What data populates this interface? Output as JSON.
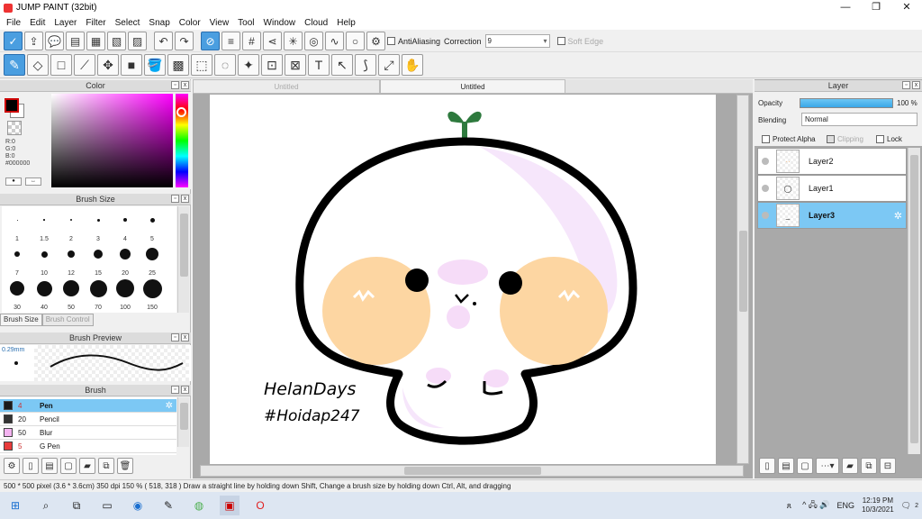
{
  "window": {
    "title": "JUMP PAINT (32bit)",
    "minimize": "—",
    "maximize": "❐",
    "close": "✕"
  },
  "menu": [
    "File",
    "Edit",
    "Layer",
    "Filter",
    "Select",
    "Snap",
    "Color",
    "View",
    "Tool",
    "Window",
    "Cloud",
    "Help"
  ],
  "toolbar1": {
    "antialiasing_label": "AntiAliasing",
    "correction_label": "Correction",
    "correction_value": "9",
    "softedge_label": "Soft Edge"
  },
  "color_panel": {
    "title": "Color",
    "rgb_text": "R:0\nG:0\nB:0\n#000000",
    "fg_color": "#000000",
    "bg_color": "#ffffff"
  },
  "brush_size_panel": {
    "title": "Brush Size",
    "sizes": [
      "1",
      "1.5",
      "2",
      "3",
      "4",
      "5",
      "7",
      "10",
      "12",
      "15",
      "20",
      "25",
      "30",
      "40",
      "50",
      "70",
      "100",
      "150"
    ],
    "tabs": [
      "Brush Size",
      "Brush Control"
    ]
  },
  "brush_preview": {
    "title": "Brush Preview",
    "size": "0.29mm"
  },
  "brush_panel": {
    "title": "Brush",
    "items": [
      {
        "num": "4",
        "name": "Pen",
        "color": "#1a1a1a"
      },
      {
        "num": "20",
        "name": "Pencil",
        "color": "#333333"
      },
      {
        "num": "50",
        "name": "Blur",
        "color": "#f3b3f0"
      },
      {
        "num": "5",
        "name": "G Pen",
        "color": "#e83b3b"
      }
    ]
  },
  "canvas": {
    "tabs": [
      "Untitled",
      "Untitled"
    ],
    "signature_line1": "HelanDays",
    "signature_line2": "#Hoidap247"
  },
  "layer_panel": {
    "title": "Layer",
    "opacity_label": "Opacity",
    "opacity_value": "100 %",
    "blending_label": "Blending",
    "blending_value": "Normal",
    "protect_alpha": "Protect Alpha",
    "clipping": "Clipping",
    "lock": "Lock",
    "layers": [
      {
        "name": "Layer2"
      },
      {
        "name": "Layer1"
      },
      {
        "name": "Layer3"
      }
    ]
  },
  "status": "500 * 500 pixel   (3.6 * 3.6cm)   350 dpi   150 %   ( 518, 318 )   Draw a straight line by holding down Shift, Change a brush size by holding down Ctrl, Alt, and dragging",
  "taskbar": {
    "lang": "ENG",
    "time": "12:19 PM",
    "date": "10/3/2021",
    "tray_icons": "^ 🖧 🔊",
    "notif_count": "2"
  }
}
